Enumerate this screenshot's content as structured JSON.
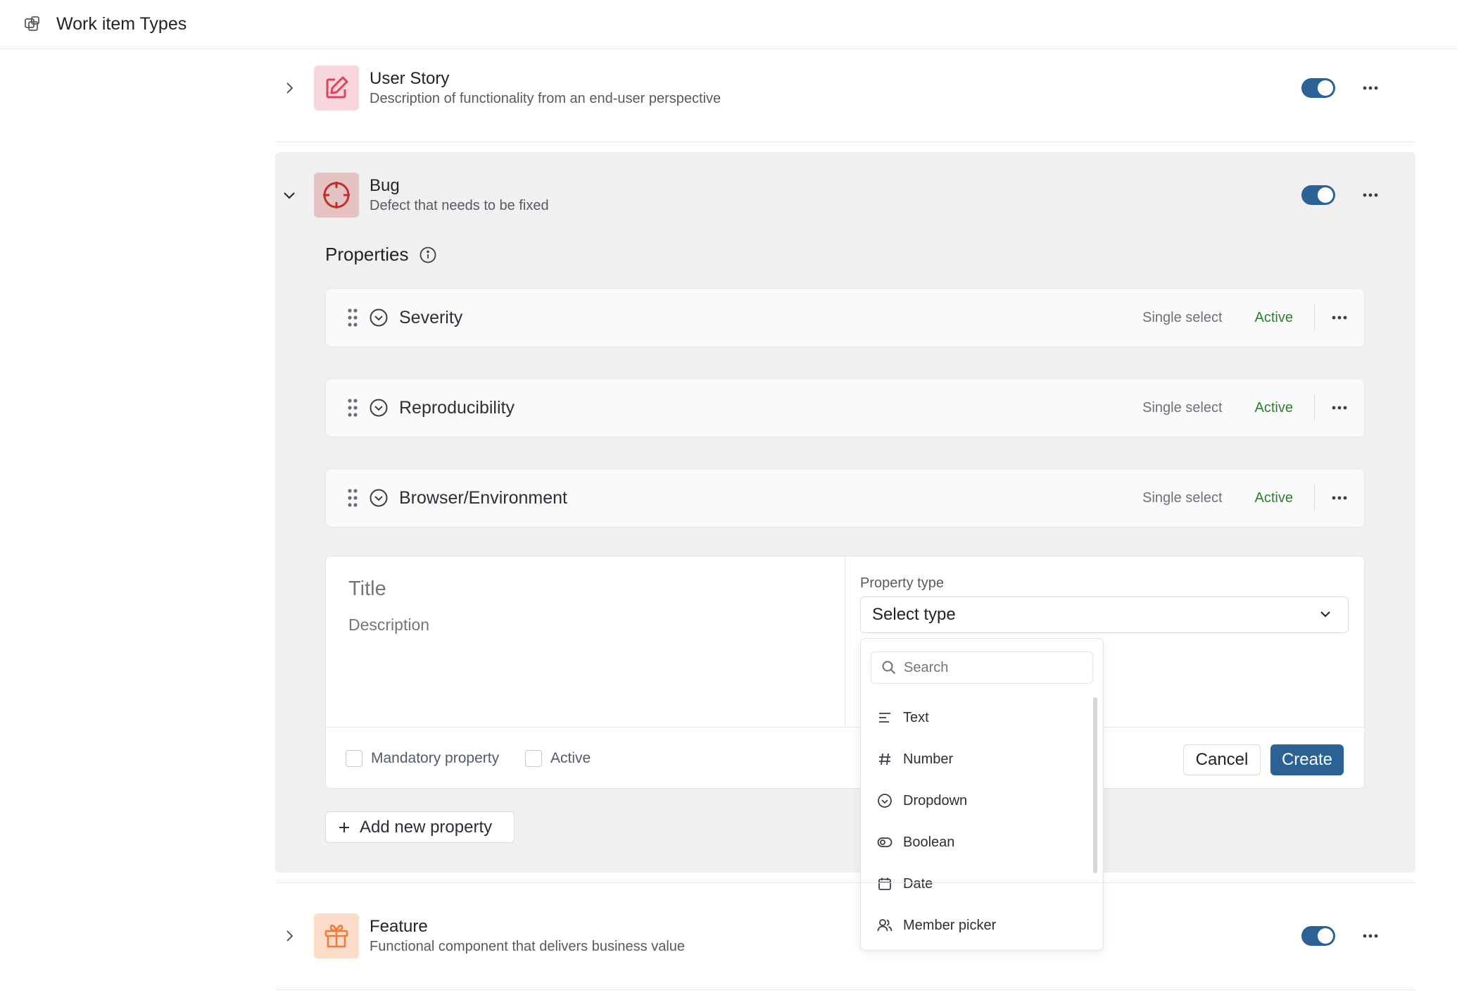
{
  "header": {
    "title": "Work item Types",
    "icon": "work-item-types-icon"
  },
  "types": [
    {
      "name": "User Story",
      "description": "Description of functionality from an end-user perspective",
      "icon": "edit-icon",
      "icon_bg": "#f7d6dc",
      "icon_color": "#e0445c",
      "expanded": false,
      "enabled": true
    },
    {
      "name": "Bug",
      "description": "Defect that needs to be fixed",
      "icon": "crosshair-icon",
      "icon_bg": "#e6c3c3",
      "icon_color": "#c0302b",
      "expanded": true,
      "enabled": true
    },
    {
      "name": "Feature",
      "description": "Functional component that delivers business value",
      "icon": "gift-icon",
      "icon_bg": "#fbdcc9",
      "icon_color": "#ec7d3c",
      "expanded": false,
      "enabled": true
    }
  ],
  "properties": {
    "title": "Properties",
    "items": [
      {
        "name": "Severity",
        "type": "Single select",
        "status": "Active"
      },
      {
        "name": "Reproducibility",
        "type": "Single select",
        "status": "Active"
      },
      {
        "name": "Browser/Environment",
        "type": "Single select",
        "status": "Active"
      }
    ]
  },
  "new_property": {
    "title_placeholder": "Title",
    "description_placeholder": "Description",
    "property_type_label": "Property type",
    "select_placeholder": "Select type",
    "mandatory_label": "Mandatory property",
    "active_label": "Active",
    "cancel": "Cancel",
    "create": "Create"
  },
  "type_dropdown": {
    "search_placeholder": "Search",
    "options": [
      {
        "label": "Text",
        "icon": "text-lines-icon"
      },
      {
        "label": "Number",
        "icon": "hash-icon"
      },
      {
        "label": "Dropdown",
        "icon": "dropdown-circle-icon"
      },
      {
        "label": "Boolean",
        "icon": "toggle-icon"
      },
      {
        "label": "Date",
        "icon": "calendar-icon"
      },
      {
        "label": "Member picker",
        "icon": "members-icon"
      }
    ]
  },
  "add_property_label": "Add new property",
  "colors": {
    "accent": "#2a6296",
    "active_green": "#2f7d32",
    "panel_bg": "#f0f0f0"
  }
}
